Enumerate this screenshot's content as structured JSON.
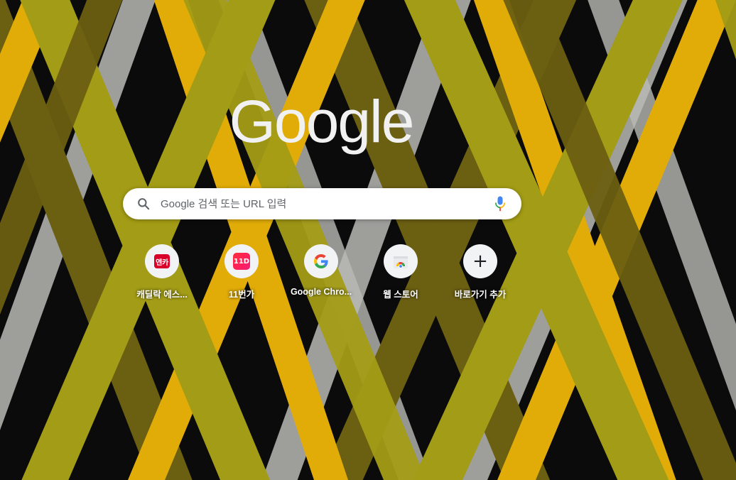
{
  "page": {
    "background_colors": {
      "base": "#0b0b0b",
      "gold": "#e1ac08",
      "olive": "#a39c16",
      "dark_olive": "#6b5f12",
      "silver": "#b9b9b5"
    }
  },
  "logo": {
    "text": "Google",
    "color": "#f1f1f1"
  },
  "search": {
    "placeholder": "Google 검색 또는 URL 입력",
    "value": "",
    "search_icon": "search-icon",
    "mic_icon": "microphone-icon"
  },
  "shortcuts": [
    {
      "title": "캐딜락 에스...",
      "icon": "enka-favicon",
      "icon_text": "엔카"
    },
    {
      "title": "11번가",
      "icon": "11st-favicon",
      "icon_text": "11D"
    },
    {
      "title": "Google Chro...",
      "icon": "google-g-icon"
    },
    {
      "title": "웹 스토어",
      "icon": "chrome-web-store-icon"
    },
    {
      "title": "바로가기 추가",
      "icon": "plus-icon",
      "icon_text": "+"
    }
  ]
}
